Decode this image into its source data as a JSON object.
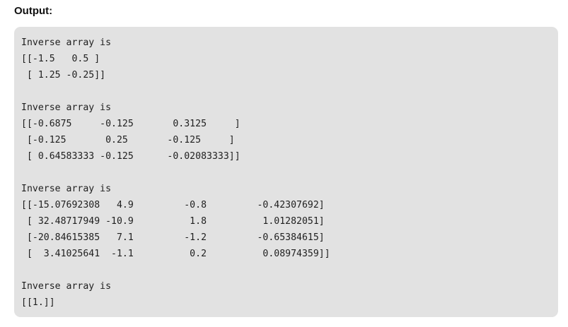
{
  "heading": "Output:",
  "output_lines": [
    "Inverse array is",
    "[[-1.5   0.5 ]",
    " [ 1.25 -0.25]]",
    "",
    "Inverse array is",
    "[[-0.6875     -0.125       0.3125     ]",
    " [-0.125       0.25       -0.125     ]",
    " [ 0.64583333 -0.125      -0.02083333]]",
    "",
    "Inverse array is",
    "[[-15.07692308   4.9         -0.8         -0.42307692]",
    " [ 32.48717949 -10.9          1.8          1.01282051]",
    " [-20.84615385   7.1         -1.2         -0.65384615]",
    " [  3.41025641  -1.1          0.2          0.08974359]]",
    "",
    "Inverse array is",
    "[[1.]]"
  ]
}
